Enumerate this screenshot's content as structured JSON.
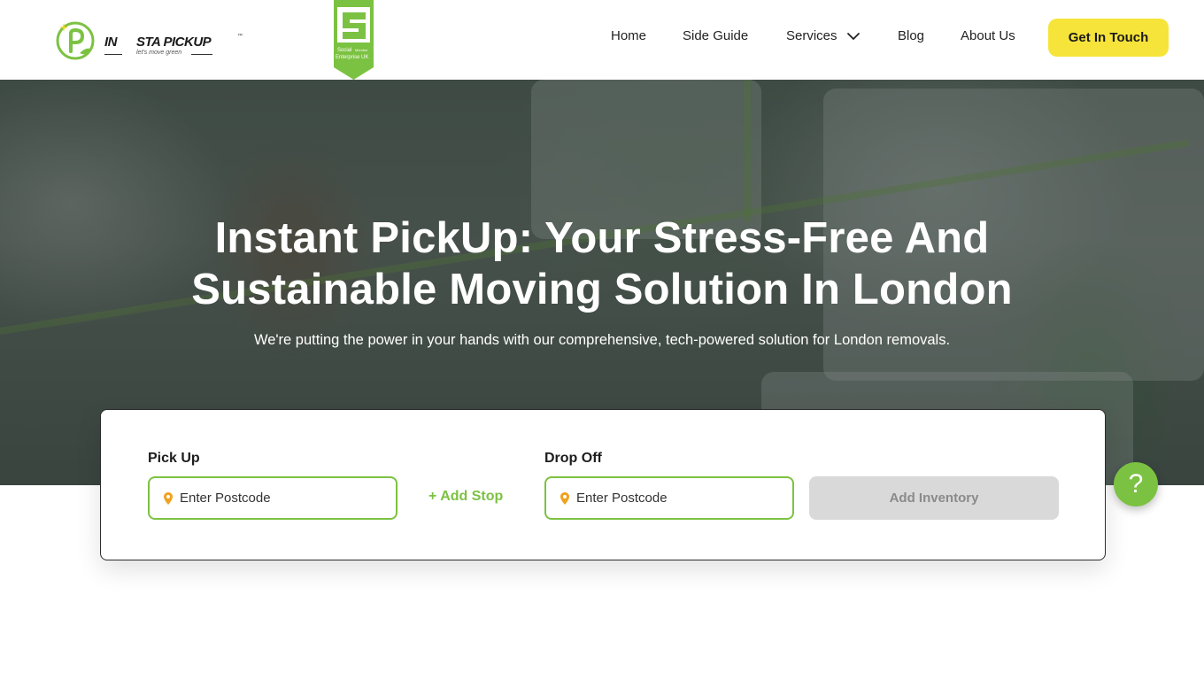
{
  "brand": {
    "logo_prefix": "IN",
    "logo_name": "STA PICKUP",
    "tagline": "let's move green",
    "trademark": "™",
    "badge_text_1": "Social",
    "badge_text_2": "Enterprise UK",
    "badge_member": "Member",
    "accent_color": "#7cc242",
    "cta_color": "#f7e43a"
  },
  "nav": {
    "items": [
      {
        "label": "Home"
      },
      {
        "label": "Side Guide"
      },
      {
        "label": "Services"
      },
      {
        "label": "Blog"
      },
      {
        "label": "About Us"
      }
    ],
    "cta_label": "Get In Touch"
  },
  "hero": {
    "title_line1": "Instant PickUp: Your Stress-Free And",
    "title_line2": "Sustainable Moving Solution In London",
    "subtitle": "We're putting the power in your hands with our comprehensive, tech-powered solution for London removals."
  },
  "booking": {
    "pickup_label": "Pick Up",
    "pickup_placeholder": "Enter Postcode",
    "add_stop_label": "+ Add Stop",
    "dropoff_label": "Drop Off",
    "dropoff_placeholder": "Enter Postcode",
    "inventory_button": "Add Inventory"
  },
  "help": {
    "icon": "question-icon",
    "glyph": "?"
  }
}
